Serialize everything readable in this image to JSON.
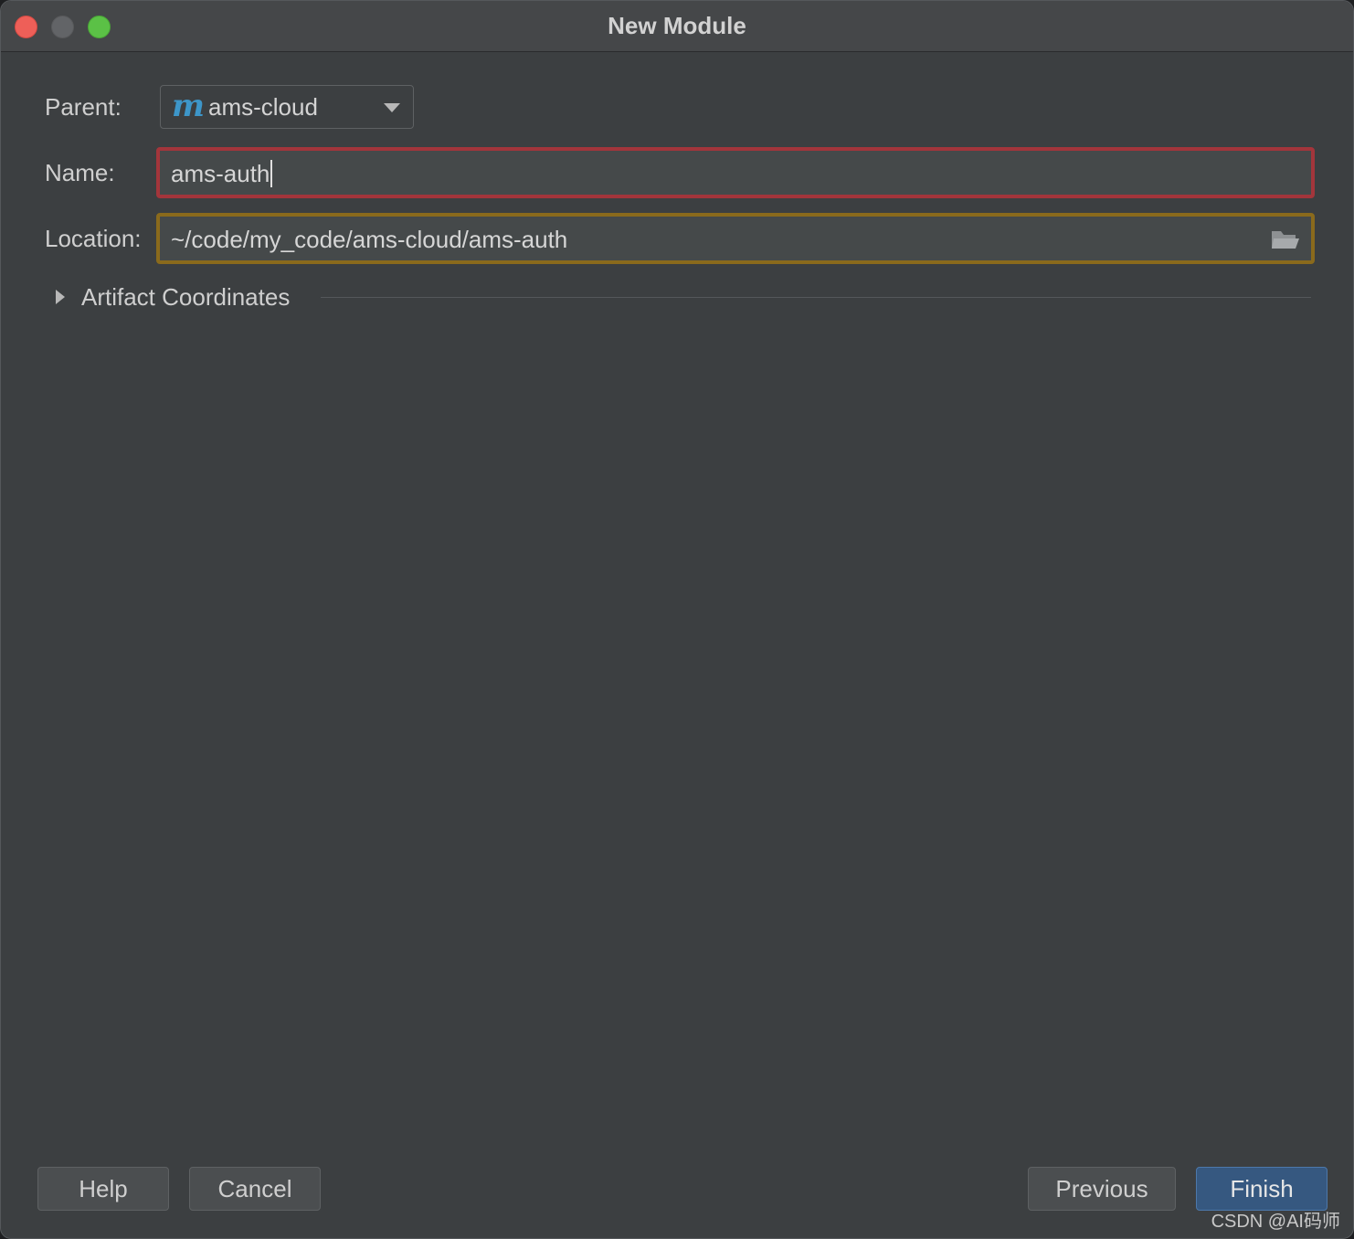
{
  "window": {
    "title": "New Module"
  },
  "form": {
    "parent_label": "Parent:",
    "parent_value": "ams-cloud",
    "parent_icon": "maven-m-icon",
    "name_label": "Name:",
    "name_value": "ams-auth",
    "location_label": "Location:",
    "location_value": "~/code/my_code/ams-cloud/ams-auth",
    "location_icon": "folder-open-icon",
    "artifact_label": "Artifact Coordinates"
  },
  "buttons": {
    "help": "Help",
    "cancel": "Cancel",
    "previous": "Previous",
    "finish": "Finish"
  },
  "watermark": "CSDN @AI码师",
  "colors": {
    "name_border_error": "#a3353b",
    "location_border_warning": "#8a6a1c",
    "finish_button": "#365880",
    "maven_icon": "#3d96c9"
  }
}
